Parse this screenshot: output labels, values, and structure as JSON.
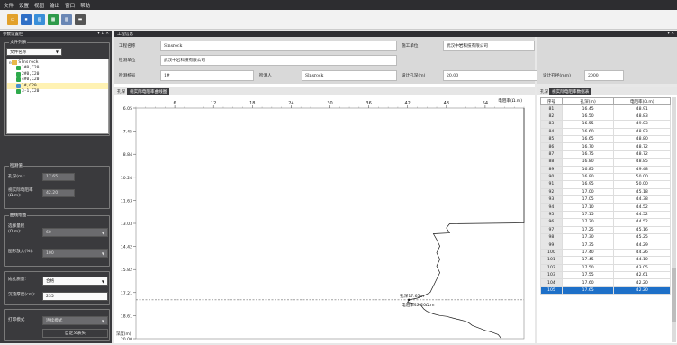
{
  "menu": {
    "items": [
      "文件",
      "设置",
      "视图",
      "输出",
      "窗口",
      "帮助"
    ]
  },
  "toolbar": {
    "icons": [
      "folder-open-icon",
      "save-icon",
      "chart-icon",
      "table-icon",
      "layout-icon",
      "print-icon"
    ]
  },
  "left_dock": {
    "title": "参数设置栏",
    "pin": "▾ ↕ ✕"
  },
  "center_dock": {
    "title": "工程信息",
    "pin": "▾ ✕"
  },
  "file_list": {
    "group_title": "文件列表",
    "sort_value": "文件名称",
    "tree_root": "Slnsrock",
    "tree_items": [
      "1#0,C20",
      "2#0,C20",
      "4#0,C20",
      "1#,C20",
      "3-1,C20"
    ],
    "selected_index": 3
  },
  "detect_value": {
    "group_title": "检测值",
    "hole_depth_label": "孔深(m):",
    "hole_depth_value": "17.65",
    "resistivity_label": "视实际电阻率(Ω.m):",
    "resistivity_value": "42.20"
  },
  "curve_settings": {
    "group_title": "曲线绘图",
    "range_label": "选择量程(Ω.m):",
    "range_value": "60",
    "zoom_label": "图形放大(%):",
    "zoom_value": "100"
  },
  "quality": {
    "label": "成孔质量:",
    "value": "合格",
    "cover_label": "沉渣厚度(cm):",
    "cover_value": "235"
  },
  "print": {
    "label": "打印模式",
    "value": "连续模式",
    "custom_button": "自定义表头"
  },
  "project_info": {
    "rows": [
      [
        {
          "label": "工程名称",
          "value": "Slnsrock"
        },
        {
          "label": "施工单位",
          "value": "武汉中岩科技有限公司"
        }
      ],
      [
        {
          "label": "检测单位",
          "value": "武汉中岩科技有限公司"
        }
      ],
      [
        {
          "label": "检测桩号",
          "value": "1#"
        },
        {
          "label": "检测人",
          "value": "Slnsrock"
        },
        {
          "label": "设计孔深(m)",
          "value": "20.00"
        },
        {
          "label": "设计孔径(mm)",
          "value": "2000"
        }
      ]
    ]
  },
  "chart_tabs": {
    "plain": "孔深",
    "active": "视实际电阻率曲线图"
  },
  "chart_data": {
    "type": "line",
    "xlabel": "电阻率(Ω.m)",
    "ylabel": "深度(m)",
    "x_ticks": [
      "6",
      "12",
      "18",
      "24",
      "30",
      "36",
      "42",
      "48",
      "54"
    ],
    "x_tick_values": [
      6,
      12,
      18,
      24,
      30,
      36,
      42,
      48,
      54
    ],
    "xlim": [
      0,
      60
    ],
    "y_ticks": [
      "6.05",
      "7.45",
      "8.84",
      "10.24",
      "11.63",
      "13.03",
      "14.42",
      "15.82",
      "17.21",
      "18.61",
      "20.00"
    ],
    "ylim": [
      6.05,
      20.0
    ],
    "annotations": [
      "孔深17.65m",
      "电阻率42.20Ω.m"
    ],
    "marker_depth": 17.65,
    "series": [
      {
        "points": [
          [
            60,
            6.05
          ],
          [
            60,
            13.0
          ],
          [
            48.5,
            13.05
          ],
          [
            48,
            13.3
          ],
          [
            48.5,
            13.6
          ],
          [
            46,
            13.65
          ],
          [
            46.5,
            14.0
          ],
          [
            47,
            14.4
          ],
          [
            46.5,
            14.8
          ],
          [
            47,
            15.2
          ],
          [
            46.5,
            15.6
          ],
          [
            47,
            16.0
          ],
          [
            46.5,
            16.4
          ],
          [
            46,
            16.8
          ],
          [
            45.5,
            17.2
          ],
          [
            44.5,
            17.4
          ],
          [
            43.5,
            17.55
          ],
          [
            42.2,
            17.65
          ],
          [
            42,
            17.8
          ],
          [
            44,
            17.95
          ],
          [
            44.5,
            18.2
          ],
          [
            45,
            18.35
          ],
          [
            46,
            18.5
          ],
          [
            47,
            18.6
          ],
          [
            48,
            18.65
          ],
          [
            49,
            18.75
          ],
          [
            50,
            18.85
          ],
          [
            51,
            18.95
          ],
          [
            51.5,
            19.05
          ],
          [
            52,
            19.2
          ],
          [
            53,
            19.35
          ],
          [
            54,
            19.5
          ],
          [
            55,
            19.6
          ],
          [
            56,
            19.75
          ],
          [
            56.5,
            20.0
          ]
        ]
      }
    ]
  },
  "data_table": {
    "tabs": {
      "plain": "孔深",
      "active": "视实际电阻率数据表"
    },
    "headers": [
      "序号",
      "孔深(m)",
      "电阻率(Ω.m)"
    ],
    "rows": [
      [
        "81",
        "16.45",
        "48.91"
      ],
      [
        "82",
        "16.50",
        "48.83"
      ],
      [
        "83",
        "16.55",
        "49.03"
      ],
      [
        "84",
        "16.60",
        "48.93"
      ],
      [
        "85",
        "16.65",
        "48.80"
      ],
      [
        "86",
        "16.70",
        "48.72"
      ],
      [
        "87",
        "16.75",
        "48.72"
      ],
      [
        "88",
        "16.80",
        "48.85"
      ],
      [
        "89",
        "16.85",
        "49.48"
      ],
      [
        "90",
        "16.90",
        "50.00"
      ],
      [
        "91",
        "16.95",
        "50.00"
      ],
      [
        "92",
        "17.00",
        "45.18"
      ],
      [
        "93",
        "17.05",
        "44.38"
      ],
      [
        "94",
        "17.10",
        "44.52"
      ],
      [
        "95",
        "17.15",
        "44.52"
      ],
      [
        "96",
        "17.20",
        "44.52"
      ],
      [
        "97",
        "17.25",
        "45.16"
      ],
      [
        "98",
        "17.30",
        "45.25"
      ],
      [
        "99",
        "17.35",
        "44.29"
      ],
      [
        "100",
        "17.40",
        "44.26"
      ],
      [
        "101",
        "17.45",
        "44.10"
      ],
      [
        "102",
        "17.50",
        "43.05"
      ],
      [
        "103",
        "17.55",
        "42.61"
      ],
      [
        "104",
        "17.60",
        "42.20"
      ],
      [
        "105",
        "17.65",
        "42.20"
      ]
    ],
    "selected_row": 24
  }
}
